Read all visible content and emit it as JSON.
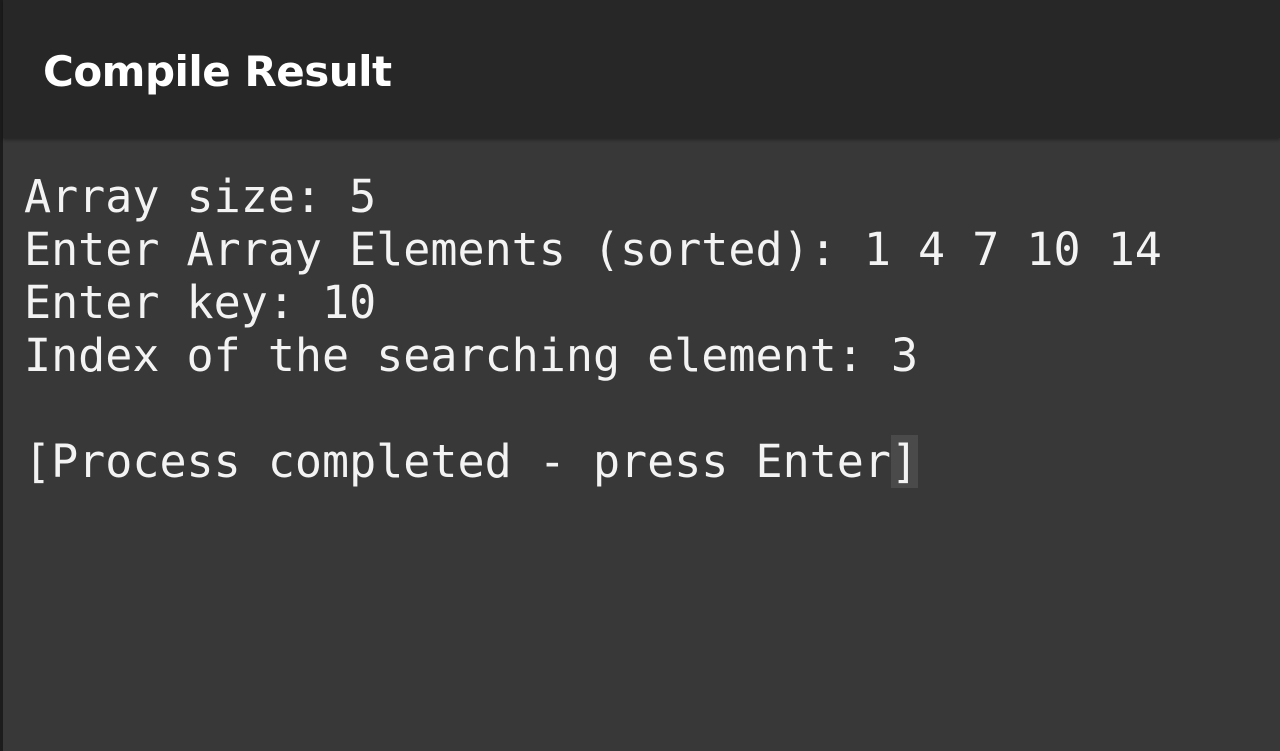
{
  "header": {
    "title": "Compile Result"
  },
  "terminal": {
    "lines": [
      "Array size: 5",
      "Enter Array Elements (sorted): 1 4 7 10 14",
      "Enter key: 10",
      "Index of the searching element: 3",
      ""
    ],
    "status_text": "[Process completed - press Enter",
    "cursor_char": "]"
  },
  "colors": {
    "header_bg": "#272727",
    "terminal_bg": "#383838",
    "text": "#f3f3f3"
  }
}
